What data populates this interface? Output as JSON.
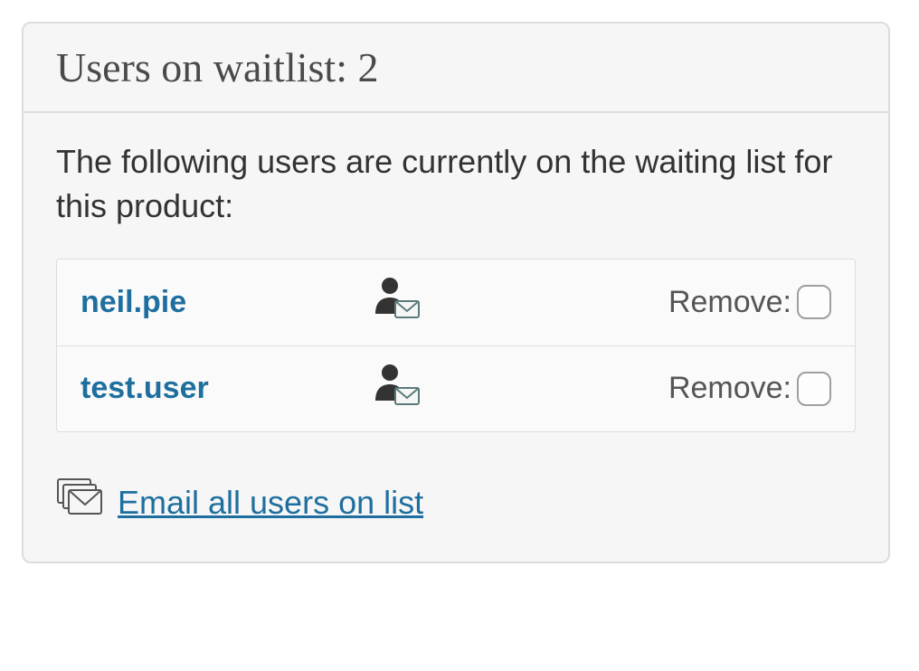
{
  "header": {
    "title_prefix": "Users on waitlist:",
    "count": "2"
  },
  "body": {
    "intro": "The following users are currently on the waiting list for this product:"
  },
  "users": [
    {
      "name": "neil.pie",
      "remove_label": "Remove:"
    },
    {
      "name": "test.user",
      "remove_label": "Remove:"
    }
  ],
  "footer": {
    "email_all": "Email all users on list"
  }
}
